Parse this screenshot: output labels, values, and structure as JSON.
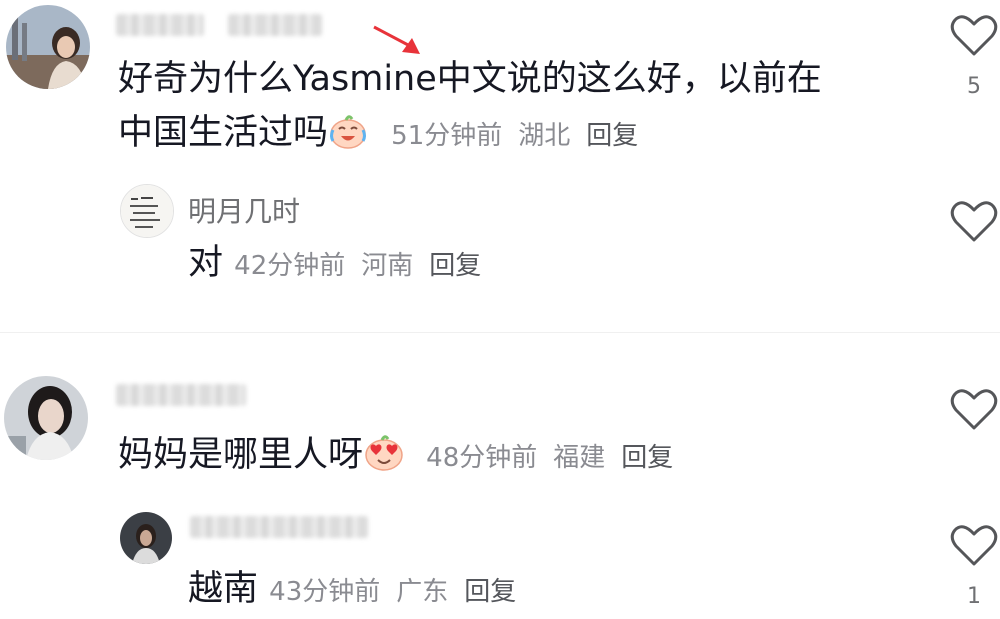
{
  "comments": [
    {
      "text_a": "好奇为什么Yasmine中文说的这么好，以前在",
      "text_b": "中国生活过吗",
      "emoji": "crying-laugh-emoji",
      "time": "51分钟前",
      "location": "湖北",
      "reply_label": "回复",
      "likes": "5",
      "reply": {
        "username": "明月几时",
        "text": "对",
        "time": "42分钟前",
        "location": "河南",
        "reply_label": "回复"
      }
    },
    {
      "text": "妈妈是哪里人呀",
      "emoji": "heart-eyes-emoji",
      "time": "48分钟前",
      "location": "福建",
      "reply_label": "回复",
      "likes": "",
      "reply": {
        "text": "越南",
        "time": "43分钟前",
        "location": "广东",
        "reply_label": "回复",
        "likes": "1"
      }
    }
  ],
  "icons": {
    "like": "heart-outline-icon",
    "annotation": "red-arrow-icon"
  },
  "colors": {
    "text": "#161823",
    "meta": "#8a8b91",
    "annotation": "#e8333a"
  }
}
